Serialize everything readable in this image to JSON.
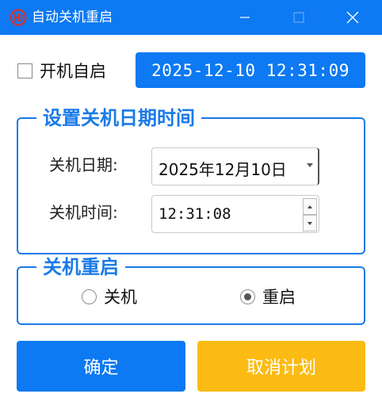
{
  "window": {
    "title": "自动关机重启",
    "icon": "red-power-logo-icon",
    "controls": [
      "minimize-icon",
      "maximize-icon",
      "close-icon"
    ]
  },
  "autostart": {
    "label": "开机自启",
    "checked": false
  },
  "clock": {
    "current_datetime": "2025-12-10 12:31:09"
  },
  "schedule_group": {
    "title": "设置关机日期时间",
    "date_label": "关机日期:",
    "date_value": "2025年12月10日",
    "time_label": "关机时间:",
    "time_value": "12:31:08"
  },
  "mode_group": {
    "title": "关机重启",
    "options": [
      {
        "label": "关机",
        "selected": false
      },
      {
        "label": "重启",
        "selected": true
      }
    ]
  },
  "buttons": {
    "confirm": "确定",
    "cancel": "取消计划"
  },
  "colors": {
    "accent_blue": "#0d79f2",
    "group_border": "#1a7ae8",
    "cancel_yellow": "#fbbb12",
    "icon_red": "#d9302c"
  }
}
